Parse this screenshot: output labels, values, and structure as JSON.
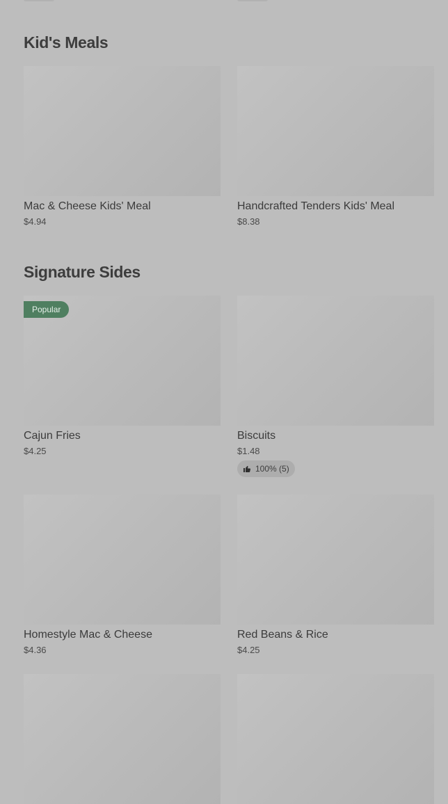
{
  "sections": [
    {
      "title": "Kid's Meals",
      "items": [
        {
          "name": "Mac & Cheese Kids' Meal",
          "price": "$4.94"
        },
        {
          "name": "Handcrafted Tenders Kids' Meal",
          "price": "$8.38"
        }
      ]
    },
    {
      "title": "Signature Sides",
      "items": [
        {
          "name": "Cajun Fries",
          "price": "$4.25",
          "badge": "Popular"
        },
        {
          "name": "Biscuits",
          "price": "$1.48",
          "rating": "100% (5)"
        },
        {
          "name": "Homestyle Mac & Cheese",
          "price": "$4.36"
        },
        {
          "name": "Red Beans & Rice",
          "price": "$4.25"
        },
        {
          "name": "",
          "price": ""
        },
        {
          "name": "",
          "price": ""
        }
      ]
    }
  ],
  "colors": {
    "background": "#bdbdbd",
    "badge": "#4f7f60",
    "pill": "#adadad"
  },
  "icons": {
    "rating": "thumbs-up-icon"
  }
}
